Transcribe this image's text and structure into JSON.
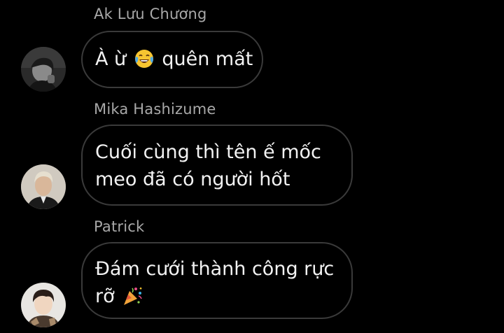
{
  "messages": [
    {
      "sender": "Ak Lưu Chương",
      "lines": [
        "À ừ",
        "quên mất"
      ],
      "emoji": "laughing-tears-icon"
    },
    {
      "sender": "Mika Hashizume",
      "lines": [
        "Cuối cùng thì tên ế mốc",
        "meo đã có người hốt"
      ]
    },
    {
      "sender": "Patrick",
      "lines": [
        "Đám cưới thành công rực",
        "rỡ"
      ],
      "emoji": "party-popper-icon"
    }
  ],
  "colors": {
    "background": "#000000",
    "bubble_border": "#3a3a3a",
    "sender_text": "#a8a8a8",
    "message_text": "#f2f2f2"
  }
}
